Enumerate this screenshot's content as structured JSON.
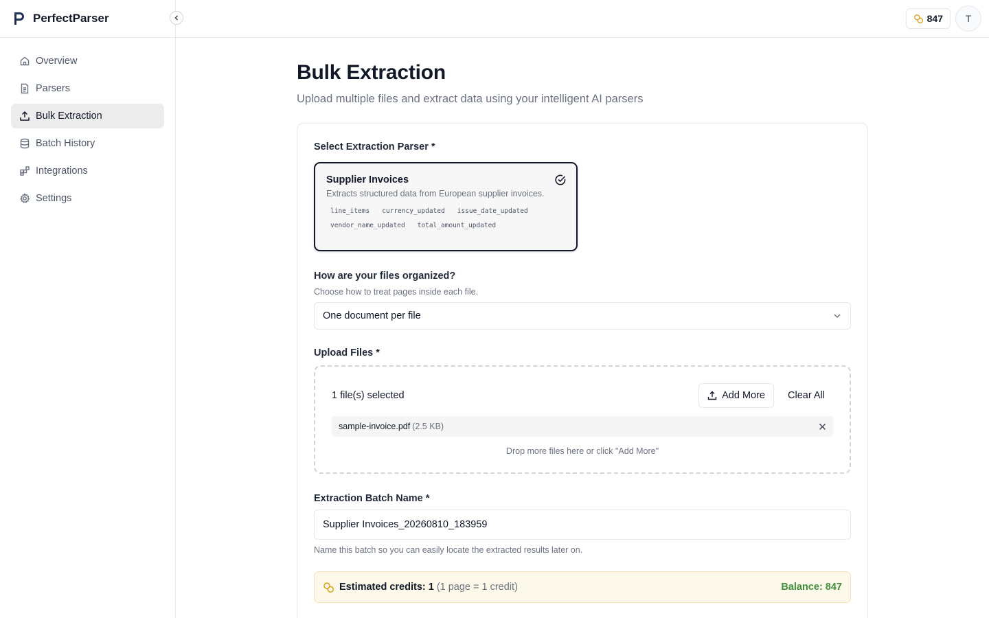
{
  "app": {
    "name": "PerfectParser"
  },
  "sidebar": {
    "items": [
      {
        "label": "Overview",
        "icon": "home-icon"
      },
      {
        "label": "Parsers",
        "icon": "document-icon"
      },
      {
        "label": "Bulk Extraction",
        "icon": "upload-icon",
        "active": true
      },
      {
        "label": "Batch History",
        "icon": "database-icon"
      },
      {
        "label": "Integrations",
        "icon": "blocks-icon"
      },
      {
        "label": "Settings",
        "icon": "gear-icon"
      }
    ]
  },
  "header": {
    "credits": "847",
    "avatar_initial": "T"
  },
  "page": {
    "title": "Bulk Extraction",
    "subtitle": "Upload multiple files and extract data using your intelligent AI parsers"
  },
  "parser_section": {
    "label": "Select Extraction Parser *",
    "selected_parser": {
      "name": "Supplier Invoices",
      "description": "Extracts structured data from European supplier invoices.",
      "fields": [
        "line_items",
        "currency_updated",
        "issue_date_updated",
        "vendor_name_updated",
        "total_amount_updated"
      ]
    }
  },
  "organization": {
    "label": "How are your files organized?",
    "help": "Choose how to treat pages inside each file.",
    "selected": "One document per file"
  },
  "upload": {
    "label": "Upload Files *",
    "count_text": "1 file(s) selected",
    "add_more": "Add More",
    "clear_all": "Clear All",
    "files": [
      {
        "name": "sample-invoice.pdf",
        "size": "(2.5 KB)"
      }
    ],
    "hint": "Drop more files here or click \"Add More\""
  },
  "batch": {
    "label": "Extraction Batch Name *",
    "value": "Supplier Invoices_20260810_183959",
    "help": "Name this batch so you can easily locate the extracted results later on."
  },
  "estimate": {
    "label": "Estimated credits: 1",
    "note": "(1 page = 1 credit)",
    "balance": "Balance: 847"
  },
  "colors": {
    "accent": "#111827",
    "coin": "#d4a017",
    "balance": "#3f8f3a",
    "estimate_bg": "#fdf9ea"
  }
}
